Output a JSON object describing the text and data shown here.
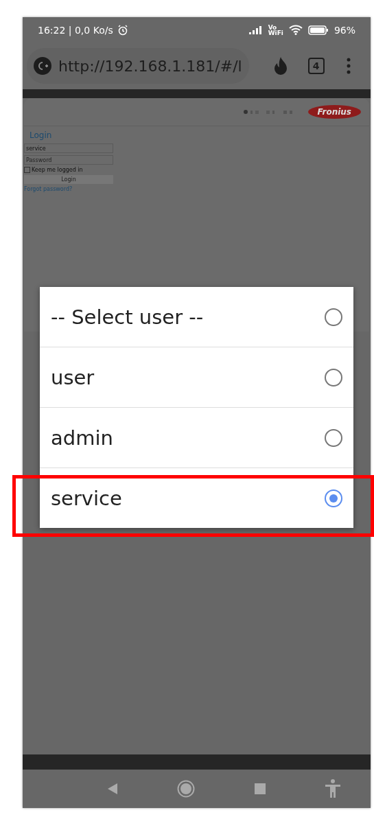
{
  "status_bar": {
    "time_speed": "16:22 | 0,0 Ko/s",
    "network_label": "Vo\nWiFi",
    "battery": "96%"
  },
  "address_bar": {
    "url": "http://192.168.1.181/#/l",
    "tab_count": "4"
  },
  "web_page": {
    "logo": "Fronius",
    "login": {
      "title": "Login",
      "user_select": "service",
      "password_placeholder": "Password",
      "keep_logged_in": {
        "label": "Keep me logged in",
        "checked": false
      },
      "button": "Login",
      "forgot_link": "Forgot password?"
    }
  },
  "select_dialog": {
    "options": [
      {
        "label": "-- Select user --",
        "selected": false
      },
      {
        "label": "user",
        "selected": false
      },
      {
        "label": "admin",
        "selected": false
      },
      {
        "label": "service",
        "selected": true
      }
    ]
  }
}
